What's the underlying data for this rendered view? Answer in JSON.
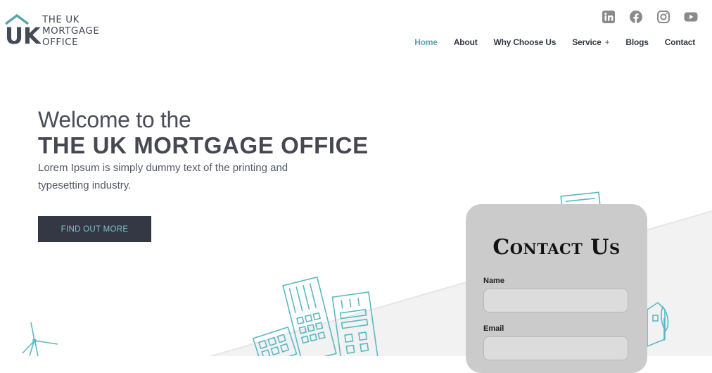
{
  "brand": {
    "line1": "THE UK",
    "line2": "MORTGAGE",
    "line3": "OFFICE",
    "mark": "UK",
    "accent": "#5aa3b1"
  },
  "social": [
    {
      "icon": "linkedin-icon"
    },
    {
      "icon": "facebook-icon"
    },
    {
      "icon": "instagram-icon"
    },
    {
      "icon": "youtube-icon"
    }
  ],
  "nav": {
    "items": [
      {
        "label": "Home",
        "active": true
      },
      {
        "label": "About"
      },
      {
        "label": "Why Choose Us"
      },
      {
        "label": "Service",
        "plus": "+"
      },
      {
        "label": "Blogs"
      },
      {
        "label": "Contact"
      }
    ]
  },
  "hero": {
    "welcome": "Welcome to the",
    "title": "THE UK MORTGAGE OFFICE",
    "subtitle": "Lorem Ipsum is simply dummy text of the printing and typesetting industry.",
    "cta": "FIND OUT MORE"
  },
  "contact": {
    "title": "Contact Us",
    "fields": [
      {
        "label": "Name",
        "value": ""
      },
      {
        "label": "Email",
        "value": ""
      }
    ]
  },
  "colors": {
    "dark": "#333844",
    "teal": "#5ab8c4",
    "card": "#cbcbcb"
  }
}
